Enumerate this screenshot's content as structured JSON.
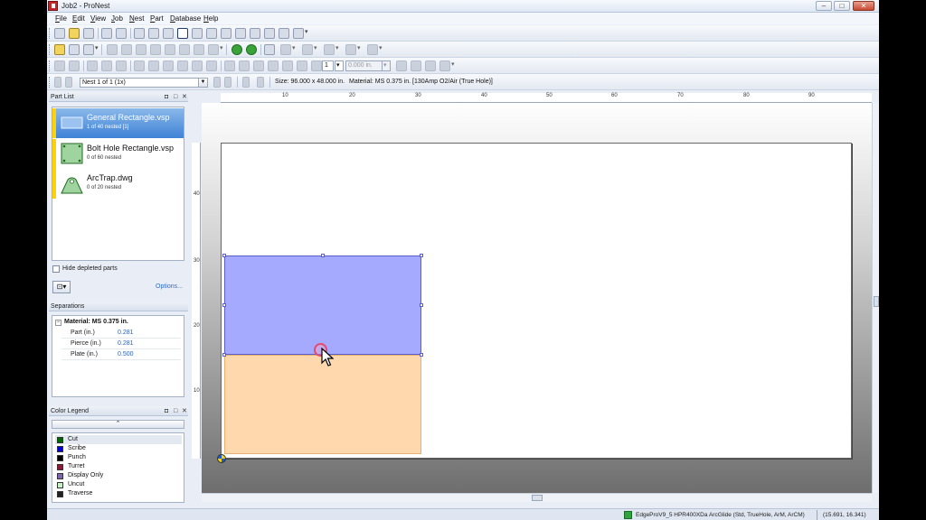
{
  "window": {
    "title": "Job2 - ProNest",
    "controls": {
      "minimize": "–",
      "maximize": "□",
      "close": "✕"
    }
  },
  "menu": [
    {
      "u": "F",
      "rest": "ile"
    },
    {
      "u": "E",
      "rest": "dit"
    },
    {
      "u": "V",
      "rest": "iew"
    },
    {
      "u": "J",
      "rest": "ob"
    },
    {
      "u": "N",
      "rest": "est"
    },
    {
      "u": "P",
      "rest": "art"
    },
    {
      "u": "D",
      "rest": "atabase"
    },
    {
      "u": "H",
      "rest": "elp"
    }
  ],
  "toolbar3": {
    "spin_value": "1",
    "distance_value": "0.000 in."
  },
  "nestbar": {
    "nest_selector": "Nest 1 of 1 (1x)",
    "size": "Size: 96.000 x 48.000 in.",
    "material": "Material: MS 0.375 in. [130Amp O2/Air (True Hole)]"
  },
  "part_list": {
    "header": "Part List",
    "items": [
      {
        "name": "General Rectangle.vsp",
        "count": "1 of 40 nested",
        "count_extra": "[1]"
      },
      {
        "name": "Bolt Hole Rectangle.vsp",
        "count": "0 of 60 nested"
      },
      {
        "name": "ArcTrap.dwg",
        "count": "0 of 20 nested"
      }
    ],
    "hide_depleted": "Hide depleted parts",
    "options": "Options..."
  },
  "separations": {
    "header": "Separations",
    "material": "Material: MS 0.375 in.",
    "rows": [
      {
        "label": "Part (in.)",
        "value": "0.281"
      },
      {
        "label": "Pierce (in.)",
        "value": "0.281"
      },
      {
        "label": "Plate (in.)",
        "value": "0.500"
      }
    ]
  },
  "color_legend": {
    "header": "Color Legend",
    "collapse": "⌃",
    "items": [
      {
        "label": "Cut",
        "color": "#006400"
      },
      {
        "label": "Scribe",
        "color": "#0000c8"
      },
      {
        "label": "Punch",
        "color": "#000000"
      },
      {
        "label": "Turret",
        "color": "#8b1a3a"
      },
      {
        "label": "Display Only",
        "color": "#7a66a8"
      },
      {
        "label": "Uncut",
        "color": "#c8f0c8"
      },
      {
        "label": "Traverse",
        "color": "#222222"
      }
    ]
  },
  "ruler_h": [
    "10",
    "20",
    "30",
    "40",
    "50",
    "60",
    "70",
    "80",
    "90"
  ],
  "ruler_v": [
    "40",
    "30",
    "20",
    "10"
  ],
  "status": {
    "machine": "EdgeProV9_5 HPR400XDa ArcGlide (Std, TrueHole, ArM, ArCM)",
    "coords": "(15.691, 16.341)"
  }
}
